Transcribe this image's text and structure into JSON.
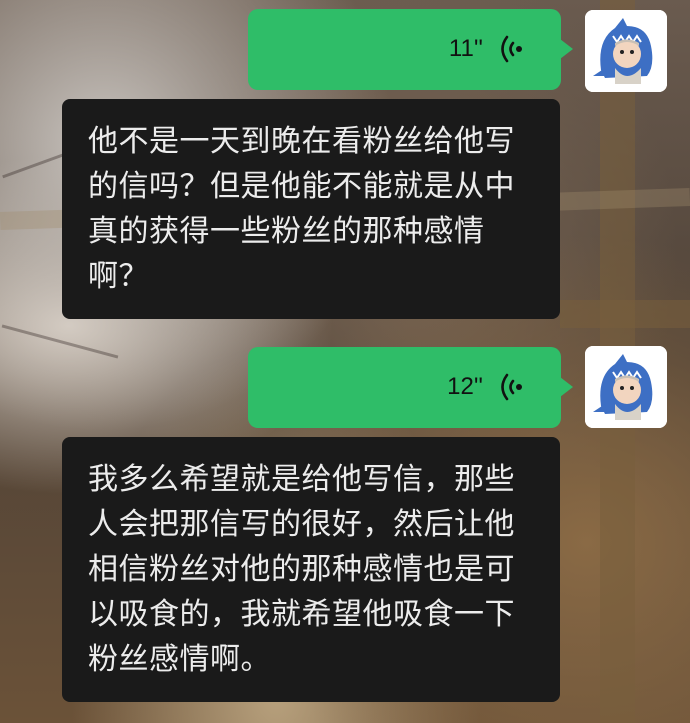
{
  "messages": [
    {
      "type": "voice",
      "duration": "11''",
      "icon": "voice-wave-icon",
      "bubble_color": "#2fbd68"
    },
    {
      "type": "text",
      "text": "他不是一天到晚在看粉丝给他写的信吗？但是他能不能就是从中真的获得一些粉丝的那种感情啊？"
    },
    {
      "type": "voice",
      "duration": "12''",
      "icon": "voice-wave-icon",
      "bubble_color": "#2fbd68"
    },
    {
      "type": "text",
      "text": "我多么希望就是给他写信，那些人会把那信写的很好，然后让他相信粉丝对他的那种感情也是可以吸食的，我就希望他吸食一下粉丝感情啊。"
    }
  ],
  "avatar": {
    "icon": "shark-costume-avatar-icon"
  }
}
